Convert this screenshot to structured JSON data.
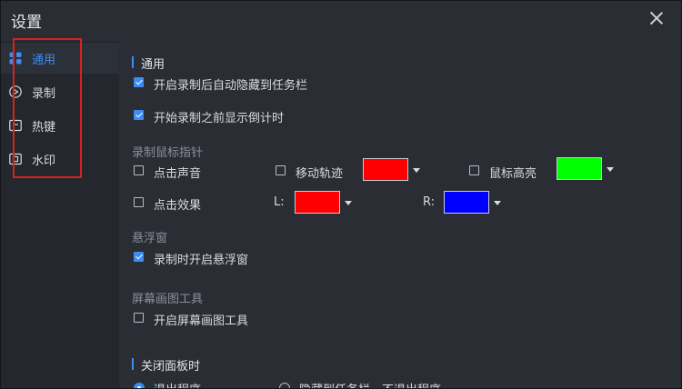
{
  "window": {
    "title": "设置"
  },
  "sidebar": {
    "items": [
      {
        "label": "通用",
        "icon": "grid-icon",
        "active": true
      },
      {
        "label": "录制",
        "icon": "record-icon",
        "active": false
      },
      {
        "label": "热键",
        "icon": "keyboard-icon",
        "active": false
      },
      {
        "label": "水印",
        "icon": "watermark-icon",
        "active": false
      }
    ]
  },
  "general": {
    "title": "通用",
    "hide_to_taskbar": {
      "label": "开启录制后自动隐藏到任务栏",
      "checked": true
    },
    "show_countdown": {
      "label": "开始录制之前显示倒计时",
      "checked": true
    }
  },
  "mouse": {
    "title": "录制鼠标指针",
    "click_sound": {
      "label": "点击声音",
      "checked": false
    },
    "move_track": {
      "label": "移动轨迹",
      "checked": false,
      "color": "#ff0000"
    },
    "cursor_highlight": {
      "label": "鼠标高亮",
      "checked": false,
      "color": "#00ff00"
    },
    "click_effect": {
      "label": "点击效果",
      "checked": false
    },
    "left_label": "L:",
    "left_color": "#ff0000",
    "right_label": "R:",
    "right_color": "#0000ff"
  },
  "float": {
    "title": "悬浮窗",
    "show_on_record": {
      "label": "录制时开启悬浮窗",
      "checked": true
    }
  },
  "draw": {
    "title": "屏幕画图工具",
    "enable": {
      "label": "开启屏幕画图工具",
      "checked": false
    }
  },
  "close_panel": {
    "title": "关闭面板时",
    "options": [
      {
        "label": "退出程序",
        "selected": true
      },
      {
        "label": "隐藏到任务栏，不退出程序",
        "selected": false
      }
    ]
  },
  "colors": {
    "accent": "#3c8cf2",
    "highlight_box": "#d42323"
  }
}
